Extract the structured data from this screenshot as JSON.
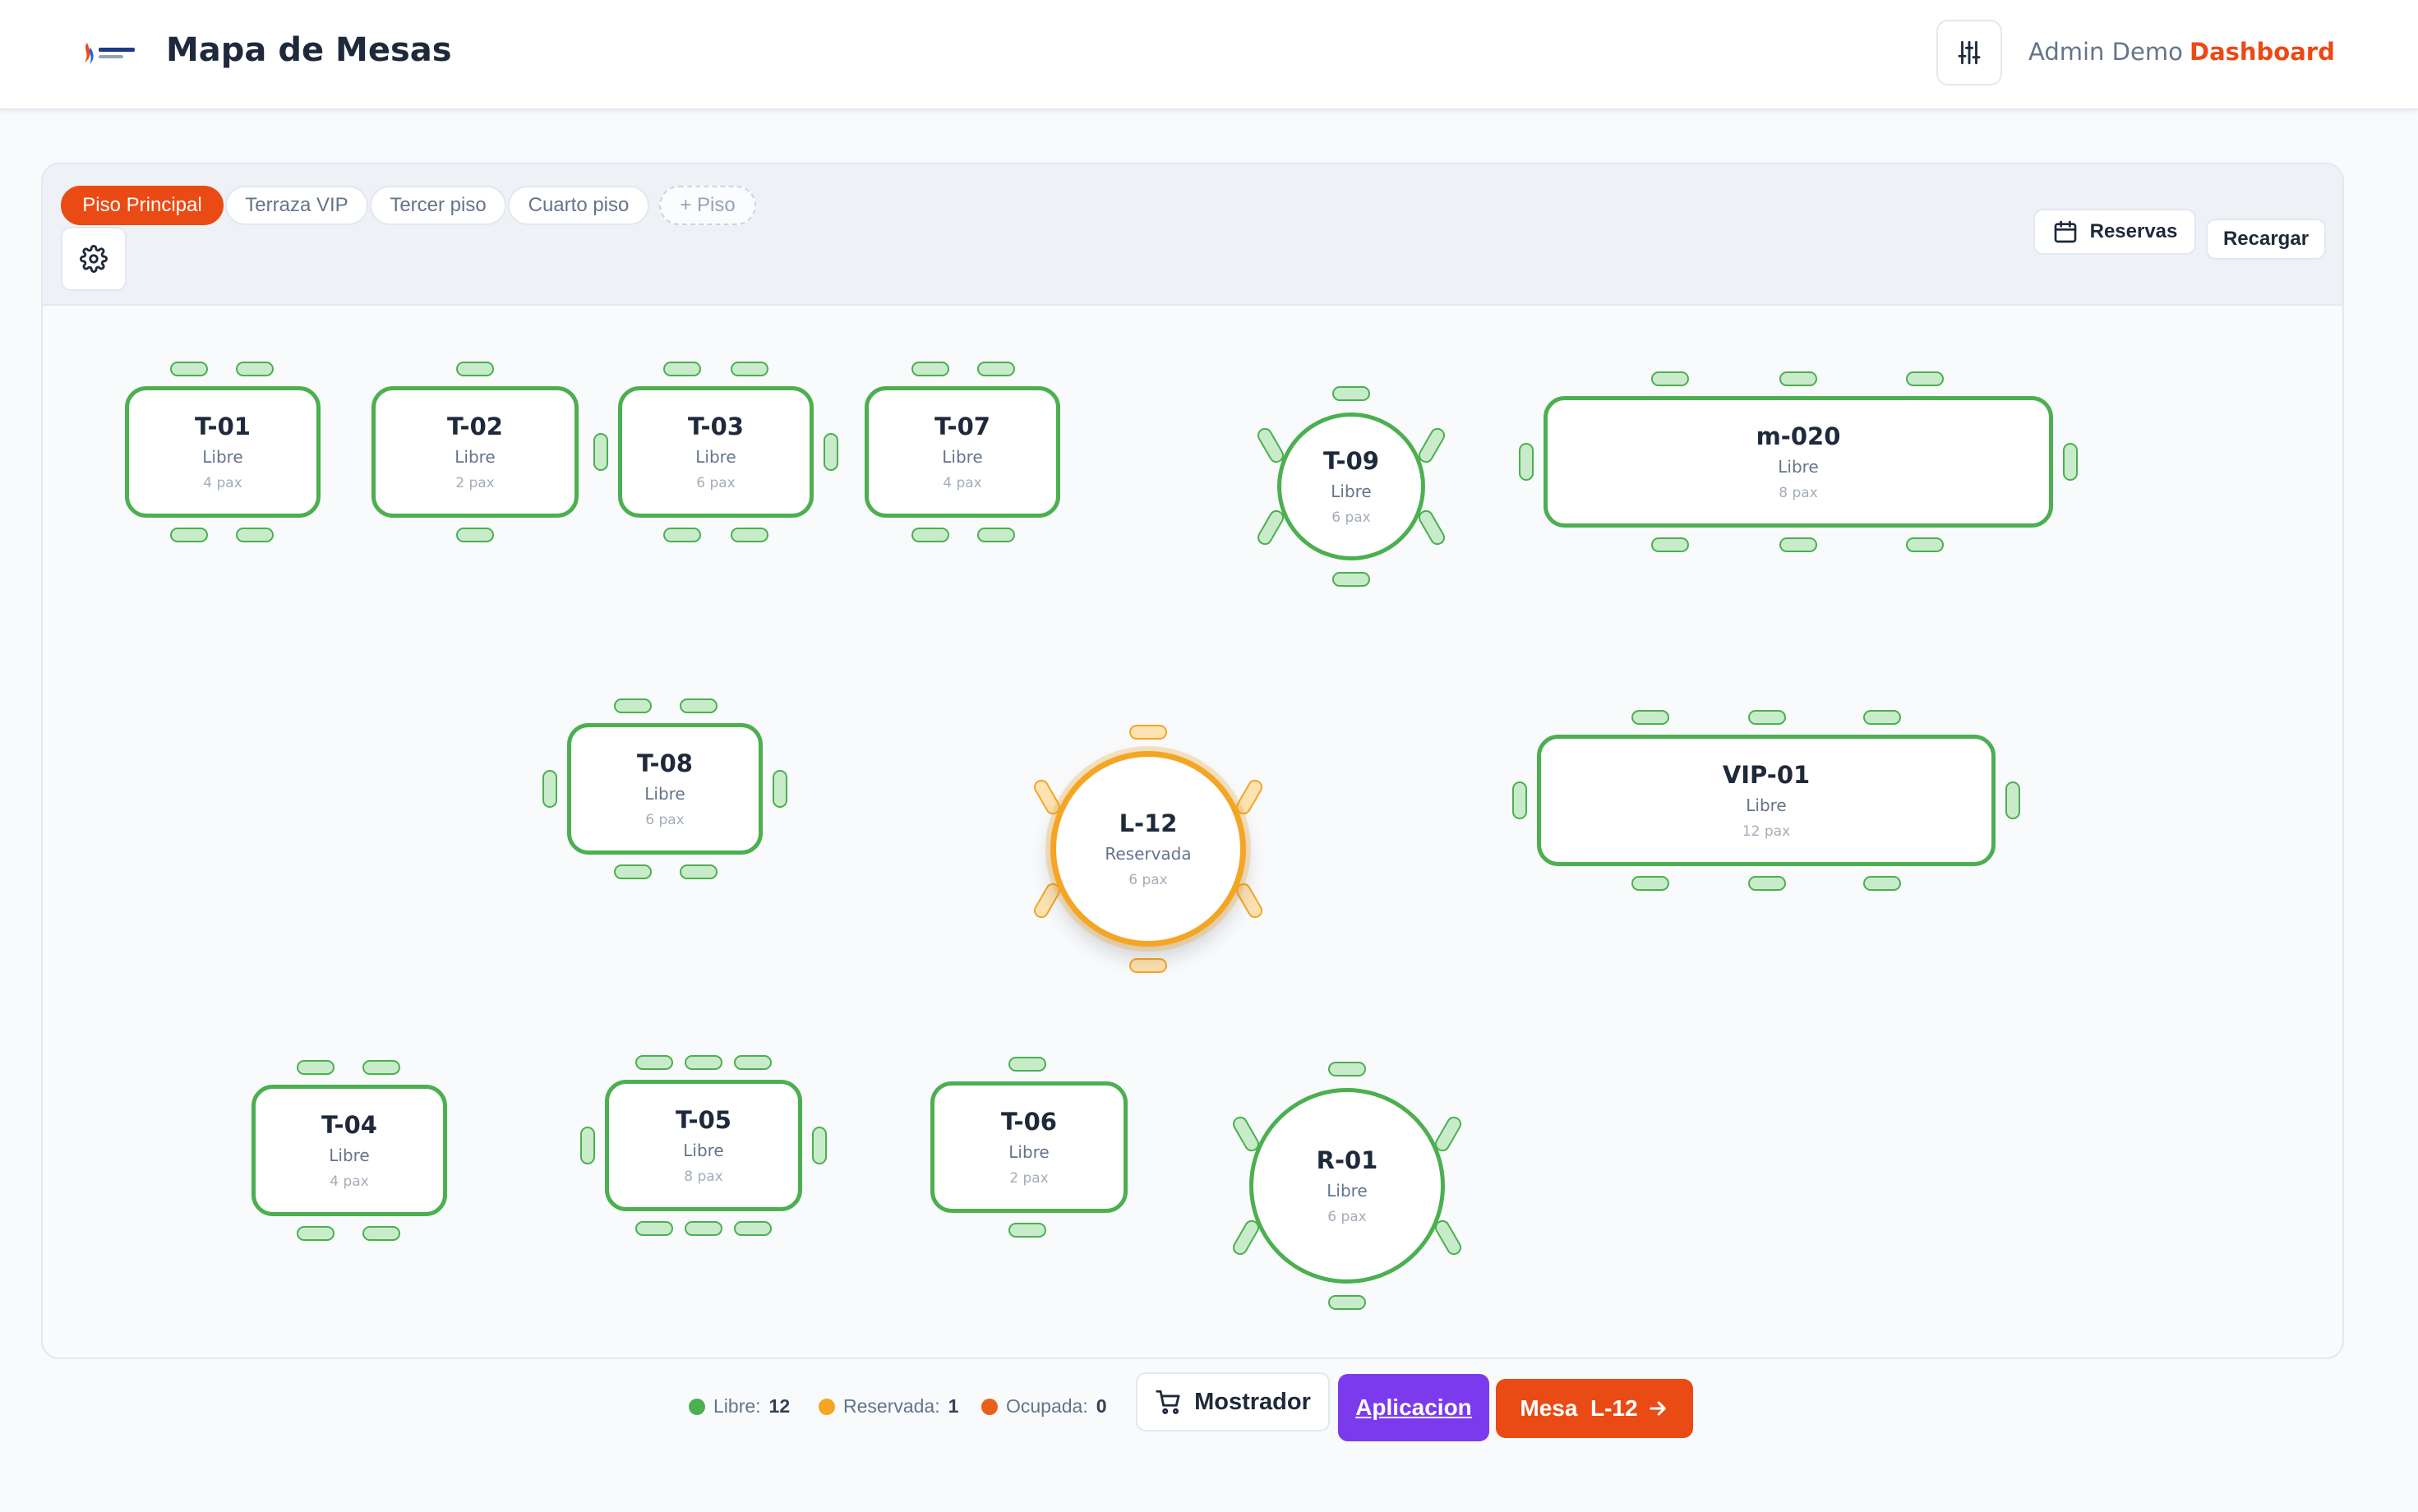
{
  "header": {
    "title": "Mapa de Mesas",
    "user": "Admin Demo",
    "dashboard_label": "Dashboard"
  },
  "floors": {
    "tabs": [
      {
        "label": "Piso Principal",
        "active": true
      },
      {
        "label": "Terraza VIP",
        "active": false
      },
      {
        "label": "Tercer piso",
        "active": false
      },
      {
        "label": "Cuarto piso",
        "active": false
      }
    ],
    "add_label": "+ Piso"
  },
  "toolbar": {
    "reservas_label": "Reservas",
    "recargar_label": "Recargar"
  },
  "tables": [
    {
      "name": "T-01",
      "status": "Libre",
      "capacity": "4 pax"
    },
    {
      "name": "T-02",
      "status": "Libre",
      "capacity": "2 pax"
    },
    {
      "name": "T-03",
      "status": "Libre",
      "capacity": "6 pax"
    },
    {
      "name": "T-07",
      "status": "Libre",
      "capacity": "4 pax"
    },
    {
      "name": "T-09",
      "status": "Libre",
      "capacity": "6 pax"
    },
    {
      "name": "m-020",
      "status": "Libre",
      "capacity": "8 pax"
    },
    {
      "name": "T-08",
      "status": "Libre",
      "capacity": "6 pax"
    },
    {
      "name": "L-12",
      "status": "Reservada",
      "capacity": "6 pax"
    },
    {
      "name": "VIP-01",
      "status": "Libre",
      "capacity": "12 pax"
    },
    {
      "name": "T-04",
      "status": "Libre",
      "capacity": "4 pax"
    },
    {
      "name": "T-05",
      "status": "Libre",
      "capacity": "8 pax"
    },
    {
      "name": "T-06",
      "status": "Libre",
      "capacity": "2 pax"
    },
    {
      "name": "R-01",
      "status": "Libre",
      "capacity": "6 pax"
    }
  ],
  "legend": {
    "libre_label": "Libre:",
    "libre_count": "12",
    "reservada_label": "Reservada:",
    "reservada_count": "1",
    "ocupada_label": "Ocupada:",
    "ocupada_count": "0"
  },
  "actions": {
    "mostrador_label": "Mostrador",
    "aplicacion_label": "Aplicacion",
    "mesa_label": "Mesa  L-12"
  },
  "colors": {
    "brand": "#ea4a14",
    "libre": "#4caf50",
    "reservada": "#f5a524",
    "ocupada": "#e8601c",
    "aplicacion": "#7c3aed"
  }
}
